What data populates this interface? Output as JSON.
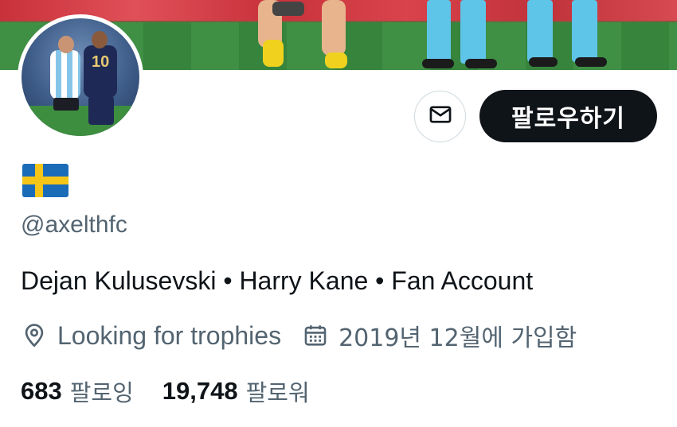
{
  "profile": {
    "handle": "@axelthfc",
    "bio": "Dejan Kulusevski • Harry Kane • Fan Account",
    "location": "Looking for trophies",
    "joined": "2019년 12월에 가입함",
    "flag": "sweden-flag"
  },
  "actions": {
    "follow_label": "팔로우하기",
    "message_icon": "mail-icon"
  },
  "stats": {
    "following_count": "683",
    "following_label": "팔로잉",
    "followers_count": "19,748",
    "followers_label": "팔로워"
  },
  "colors": {
    "text_primary": "#0f1419",
    "text_secondary": "#536471",
    "button_dark": "#0f1419",
    "border": "#cfd9de"
  }
}
